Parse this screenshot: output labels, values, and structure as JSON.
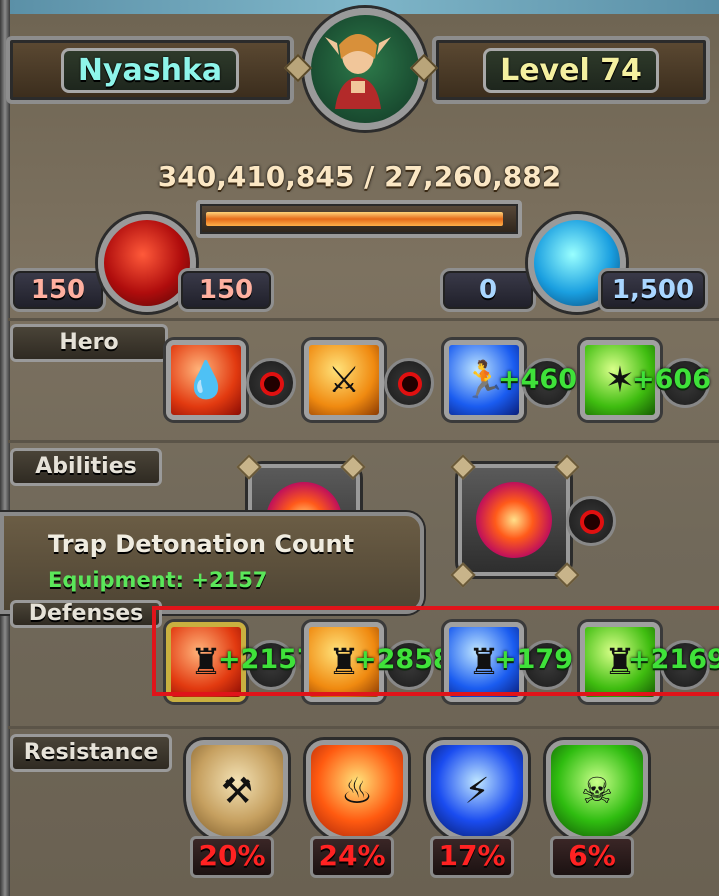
{
  "header": {
    "hero_name": "Nyashka",
    "level_label": "Level 74",
    "xp_text": "340,410,845 / 27,260,882",
    "xp_progress": 0.97
  },
  "resources": {
    "hp_left": "150",
    "hp_right": "150",
    "mana_left": "0",
    "mana_right": "1,500"
  },
  "sections": {
    "hero": {
      "label": "Hero",
      "stats": [
        {
          "icon": "health-drops-icon",
          "color": "red",
          "bonus": ""
        },
        {
          "icon": "sword-attack-icon",
          "color": "orange",
          "bonus": ""
        },
        {
          "icon": "speed-runner-icon",
          "color": "blue",
          "bonus": "+460"
        },
        {
          "icon": "cast-rate-icon",
          "color": "green",
          "bonus": "+606"
        }
      ]
    },
    "abilities": {
      "label": "Abilities"
    },
    "defenses": {
      "label": "Defenses",
      "stats": [
        {
          "icon": "tower-health-icon",
          "color": "red",
          "bonus": "+2157"
        },
        {
          "icon": "tower-damage-icon",
          "color": "orange",
          "bonus": "+2858"
        },
        {
          "icon": "tower-range-icon",
          "color": "blue",
          "bonus": "+179"
        },
        {
          "icon": "tower-rate-icon",
          "color": "green",
          "bonus": "+2169"
        }
      ]
    },
    "resistance": {
      "label": "Resistance",
      "items": [
        {
          "icon": "physical-shield-icon",
          "value": "20%"
        },
        {
          "icon": "fire-shield-icon",
          "value": "24%"
        },
        {
          "icon": "lightning-shield-icon",
          "value": "17%"
        },
        {
          "icon": "poison-shield-icon",
          "value": "6%"
        }
      ]
    }
  },
  "tooltip": {
    "title": "Trap Detonation Count",
    "detail": "Equipment: +2157"
  }
}
